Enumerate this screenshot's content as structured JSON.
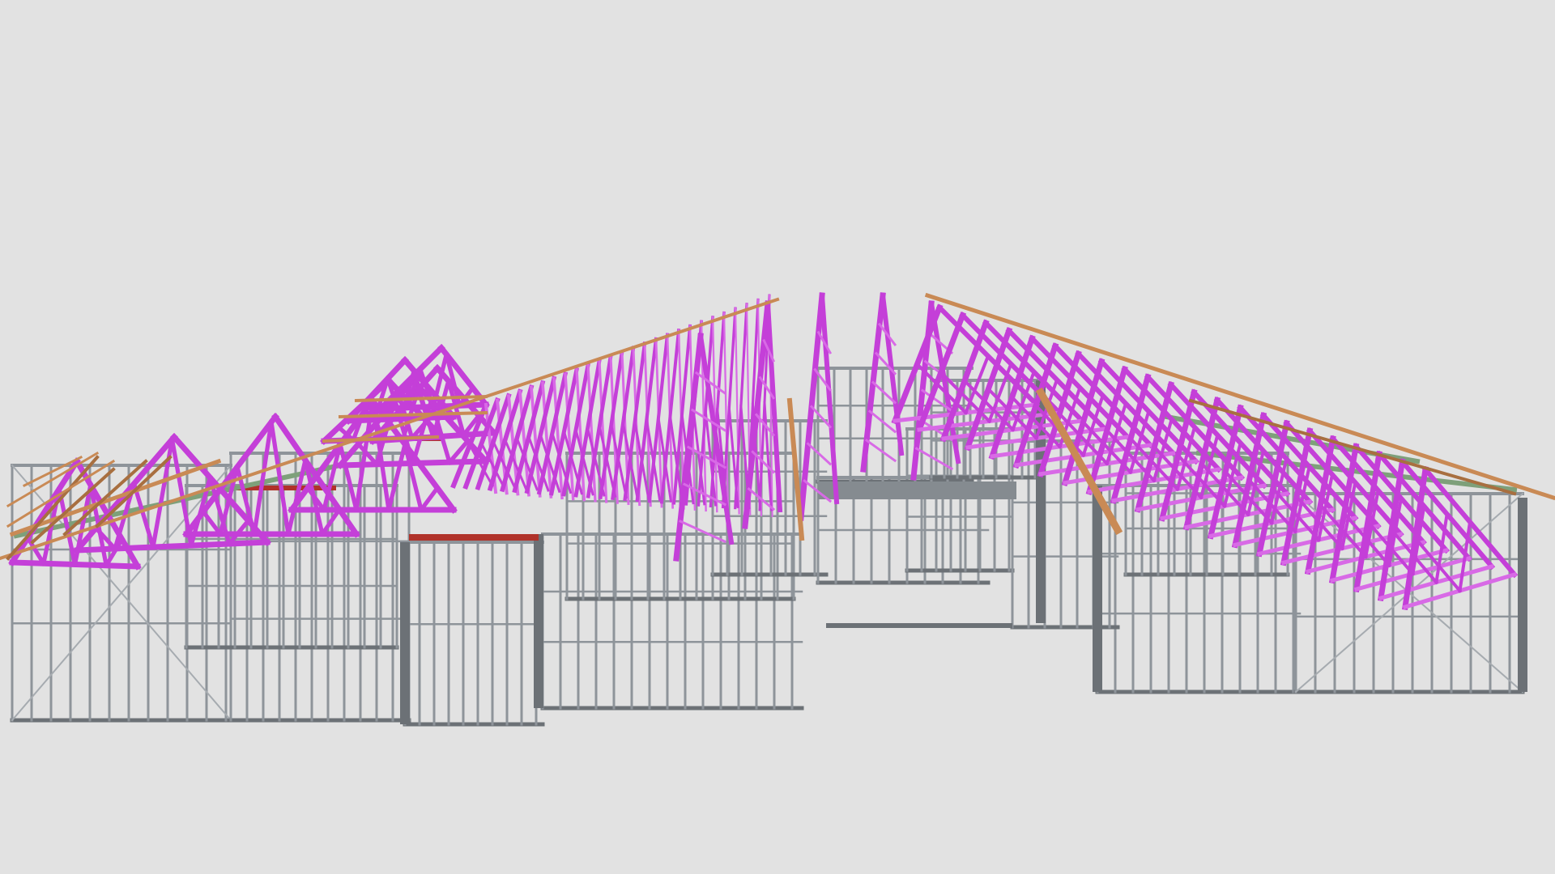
{
  "viewer": {
    "background": "#e2e2e2"
  },
  "model": {
    "subject": "3d-building-frame-model",
    "colors": {
      "wall_steel": "#8e949a",
      "wall_steel_dark": "#6c7176",
      "truss": "#c43fd8",
      "truss_light": "#d86ae6",
      "timber_fascia": "#c98a55",
      "timber_dark": "#a86f40",
      "lintel": "#b0322a",
      "ceiling_batten": "#7ea07a"
    }
  }
}
